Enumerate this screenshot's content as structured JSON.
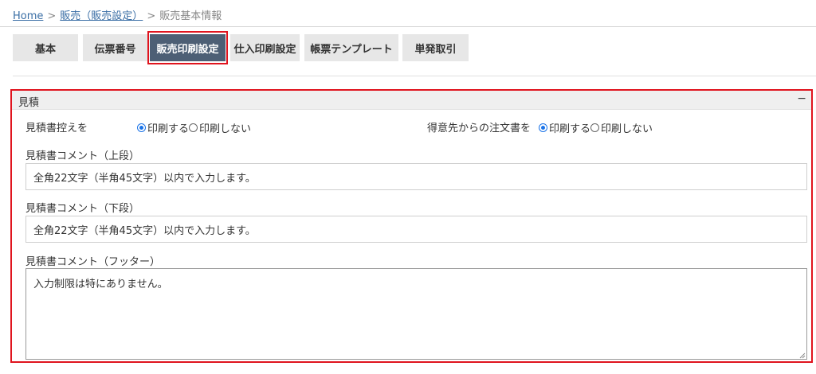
{
  "breadcrumb": {
    "home": "Home",
    "sales_settings": "販売（販売設定）",
    "current": "販売基本情報",
    "separator": ">"
  },
  "tabs": [
    {
      "label": "基本",
      "active": false
    },
    {
      "label": "伝票番号",
      "active": false
    },
    {
      "label": "販売印刷設定",
      "active": true
    },
    {
      "label": "仕入印刷設定",
      "active": false
    },
    {
      "label": "帳票テンプレート",
      "active": false
    },
    {
      "label": "単発取引",
      "active": false
    }
  ],
  "estimate": {
    "title": "見積",
    "collapse_symbol": "−",
    "copy_label": "見積書控えを",
    "copy_options": [
      "印刷する",
      "印刷しない"
    ],
    "copy_selected": "印刷する",
    "order_label": "得意先からの注文書を",
    "order_options": [
      "印刷する",
      "印刷しない"
    ],
    "order_selected": "印刷する",
    "comment_upper_label": "見積書コメント（上段）",
    "comment_upper_value": "全角22文字（半角45文字）以内で入力します。",
    "comment_lower_label": "見積書コメント（下段）",
    "comment_lower_value": "全角22文字（半角45文字）以内で入力します。",
    "comment_footer_label": "見積書コメント（フッター）",
    "comment_footer_value": "入力制限は特にありません。"
  },
  "colors": {
    "active_tab": "#4d5f75",
    "highlight": "#e0141e",
    "radio_checked": "#1a73e8",
    "link": "#3a6ea5"
  }
}
